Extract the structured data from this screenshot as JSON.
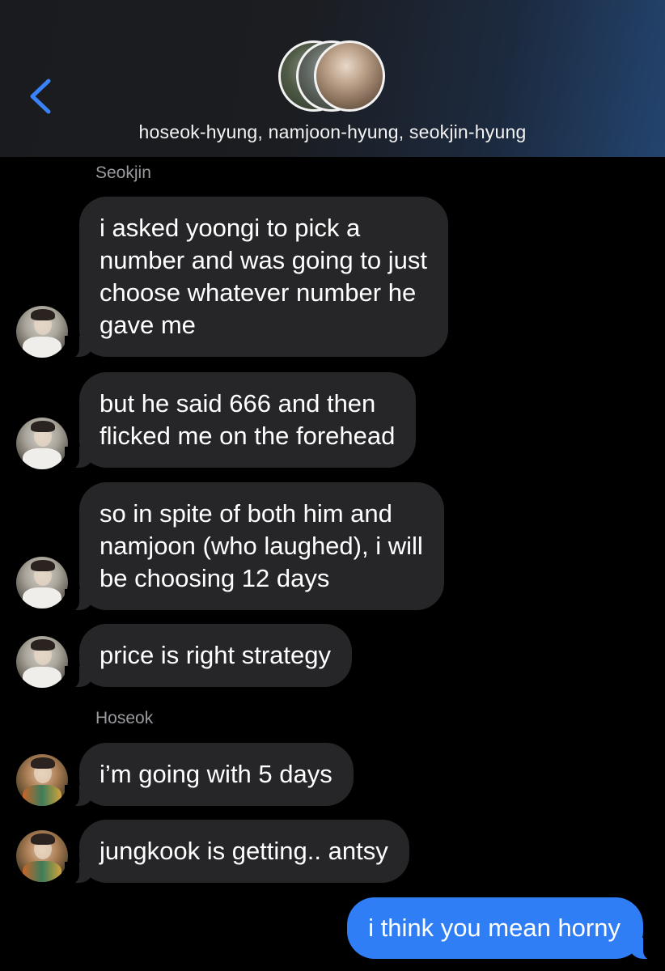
{
  "header": {
    "title": "hoseok-hyung, namjoon-hyung, seokjin-hyung",
    "back_icon": "chevron-left-icon",
    "accent": "#3a82f7"
  },
  "messages": [
    {
      "sender_label": "Seokjin"
    },
    {
      "text": "i asked yoongi to pick a\nnumber and was going to just\nchoose whatever number he\ngave me"
    },
    {
      "text": "but he said 666 and then\nflicked me on the forehead"
    },
    {
      "text": "so in spite of both him and\nnamjoon (who laughed), i will\nbe choosing 12 days"
    },
    {
      "text": "price is right strategy"
    },
    {
      "sender_label": "Hoseok"
    },
    {
      "text": "i’m going with 5 days"
    },
    {
      "text": "jungkook is getting.. antsy"
    },
    {
      "text": "i think you mean horny",
      "outgoing": true
    }
  ],
  "colors": {
    "incoming_bubble": "#262629",
    "outgoing_bubble": "#2f7ef6",
    "background": "#000000"
  }
}
